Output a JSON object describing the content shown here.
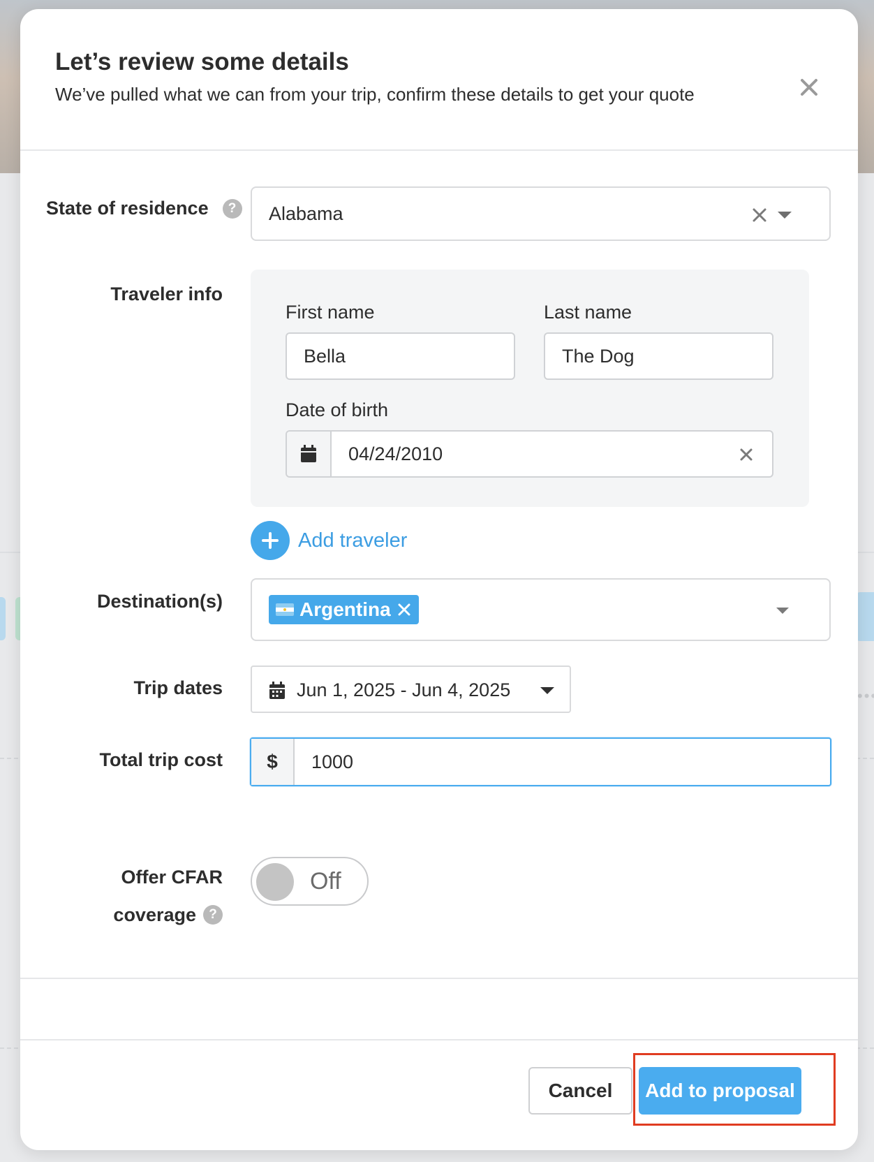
{
  "modal": {
    "title": "Let’s review some details",
    "subtitle": "We’ve pulled what we can from your trip, confirm these details to get your quote"
  },
  "state": {
    "label": "State of residence",
    "value": "Alabama"
  },
  "traveler": {
    "section_label": "Traveler info",
    "first_name_label": "First name",
    "first_name_value": "Bella",
    "last_name_label": "Last name",
    "last_name_value": "The Dog",
    "dob_label": "Date of birth",
    "dob_value": "04/24/2010",
    "add_label": "Add traveler"
  },
  "destination": {
    "label": "Destination(s)",
    "tags": [
      {
        "name": "Argentina",
        "flag": "argentina-flag-icon"
      }
    ]
  },
  "trip_dates": {
    "label": "Trip dates",
    "value": "Jun 1, 2025 - Jun 4, 2025"
  },
  "trip_cost": {
    "label": "Total trip cost",
    "currency": "$",
    "value": "1000"
  },
  "cfar": {
    "label_line1": "Offer CFAR",
    "label_line2": "coverage",
    "toggle_text": "Off"
  },
  "footer": {
    "cancel_label": "Cancel",
    "primary_label": "Add to proposal"
  },
  "colors": {
    "accent": "#4aacef",
    "highlight": "#e03c21",
    "toggle_off": "#c4c4c4"
  }
}
